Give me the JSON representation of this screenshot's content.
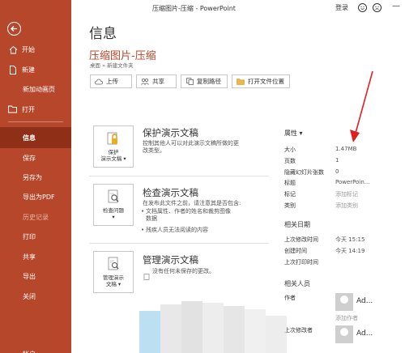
{
  "window": {
    "title": "压缩图片-压缩 - PowerPoint",
    "login": "登录",
    "minimize": "—",
    "close": "✕"
  },
  "sidebar": {
    "items": [
      {
        "label": "开始",
        "icon": "home-icon"
      },
      {
        "label": "新建",
        "icon": "new-doc-icon"
      },
      {
        "label": "新加动画页",
        "icon": ""
      },
      {
        "label": "打开",
        "icon": "open-folder-icon"
      },
      {
        "label": "信息",
        "icon": ""
      },
      {
        "label": "保存",
        "icon": ""
      },
      {
        "label": "另存为",
        "icon": ""
      },
      {
        "label": "导出为PDF",
        "icon": ""
      },
      {
        "label": "历史记录",
        "icon": ""
      },
      {
        "label": "打印",
        "icon": ""
      },
      {
        "label": "共享",
        "icon": ""
      },
      {
        "label": "导出",
        "icon": ""
      },
      {
        "label": "关闭",
        "icon": ""
      },
      {
        "label": "帐户",
        "icon": ""
      }
    ]
  },
  "main": {
    "page_title": "信息",
    "doc_name": "压缩图片-压缩",
    "breadcrumb": "桌面 » 新建文件夹",
    "toolbar": [
      "上传",
      "共享",
      "复制路径",
      "打开文件位置"
    ],
    "sections": {
      "protect": {
        "button": [
          "保护",
          "演示文稿 ▾"
        ],
        "title": "保护演示文稿",
        "desc": [
          "控制其他人可以对此演示文稿所做的更",
          "改类型。"
        ]
      },
      "inspect": {
        "button": [
          "检查问题",
          "▾"
        ],
        "title": "检查演示文稿",
        "desc": "在发布此文件之前，请注意其是否包含:",
        "bullets": [
          [
            "文档属性、作者的姓名和裁剪图像",
            "数据"
          ],
          [
            "残疾人员无法阅读的内容"
          ]
        ]
      },
      "manage": {
        "button": [
          "管理演示",
          "文稿 ▾"
        ],
        "title": "管理演示文稿",
        "desc": "没有任何未保存的更改。"
      }
    }
  },
  "properties": {
    "title": "属性 ▾",
    "rows": [
      {
        "label": "大小",
        "value": "1.47MB",
        "muted": false
      },
      {
        "label": "页数",
        "value": "1",
        "muted": false
      },
      {
        "label": "隐藏幻灯片张数",
        "value": "0",
        "muted": false
      },
      {
        "label": "标题",
        "value": "PowerPoin...",
        "muted": false
      },
      {
        "label": "标记",
        "value": "添加标记",
        "muted": true
      },
      {
        "label": "类别",
        "value": "添加类别",
        "muted": true
      }
    ],
    "dates_title": "相关日期",
    "dates": [
      {
        "label": "上次修改时间",
        "value": "今天 15:15"
      },
      {
        "label": "创建时间",
        "value": "今天 14:19"
      },
      {
        "label": "上次打印时间",
        "value": ""
      }
    ],
    "people_title": "相关人员",
    "author_label": "作者",
    "author_name": "Ad...",
    "add_author": "添加作者",
    "modifier_label": "上次修改者",
    "modifier_name": "Ad..."
  },
  "colors": {
    "sidebar": "#b7472a",
    "selected": "#8f2f18",
    "accent": "#b7472a"
  }
}
